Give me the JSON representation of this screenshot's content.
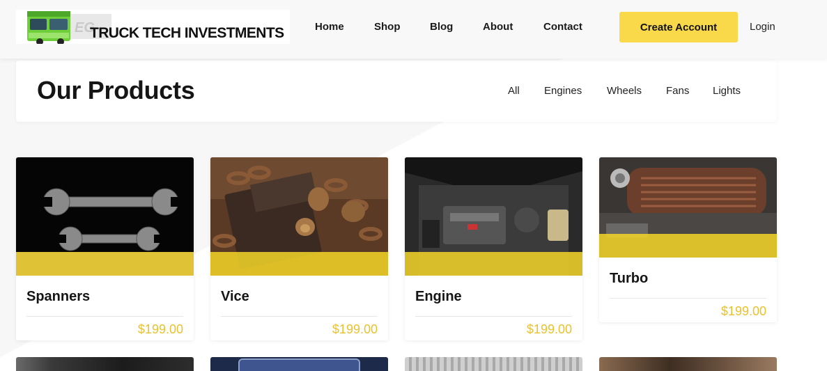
{
  "header": {
    "logo": {
      "text": "TRUCK TECH INVESTMENTS",
      "icon": "truck-logo-icon"
    },
    "nav": [
      {
        "label": "Home"
      },
      {
        "label": "Shop"
      },
      {
        "label": "Blog"
      },
      {
        "label": "About"
      },
      {
        "label": "Contact"
      }
    ],
    "create_account_label": "Create Account",
    "login_label": "Login"
  },
  "products": {
    "title": "Our Products",
    "filters": [
      {
        "label": "All"
      },
      {
        "label": "Engines"
      },
      {
        "label": "Wheels"
      },
      {
        "label": "Fans"
      },
      {
        "label": "Lights"
      }
    ],
    "items": [
      {
        "name": "Spanners",
        "price": "$199.00",
        "image": "spanners-photo"
      },
      {
        "name": "Vice",
        "price": "$199.00",
        "image": "vice-photo"
      },
      {
        "name": "Engine",
        "price": "$199.00",
        "image": "engine-photo"
      },
      {
        "name": "Turbo",
        "price": "$199.00",
        "image": "turbo-photo"
      }
    ],
    "next_row_images": [
      "car-photo",
      "toolbox-photo",
      "tire-photo",
      "parts-photo"
    ]
  },
  "colors": {
    "accent": "#f9d949",
    "price": "#e9c22e",
    "text": "#151515"
  }
}
